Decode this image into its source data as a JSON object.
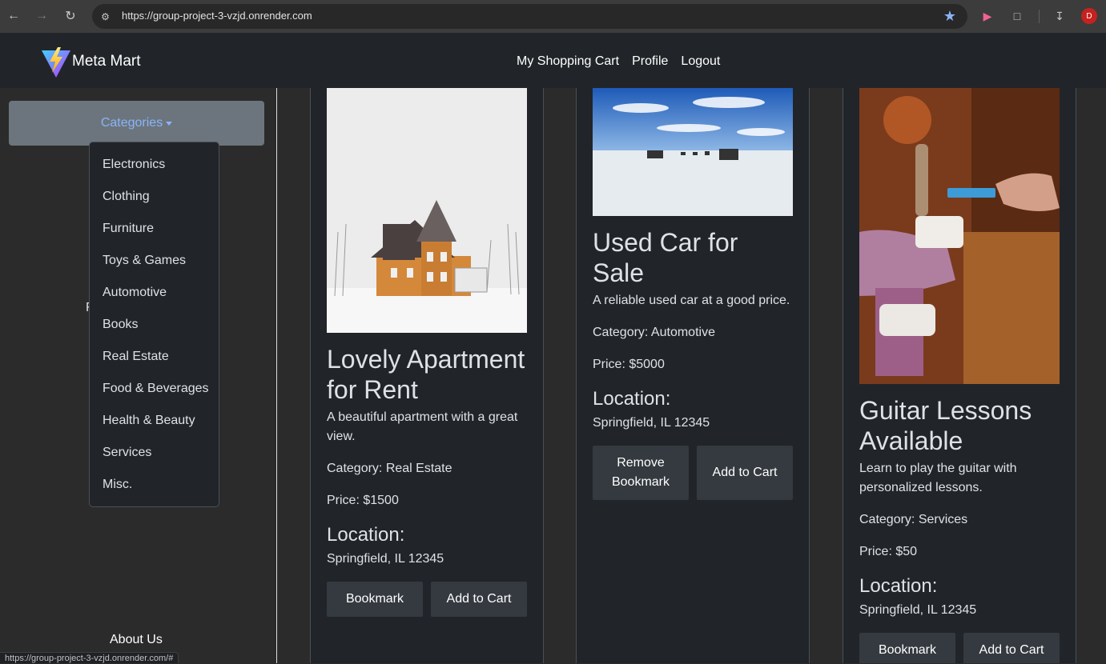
{
  "browser": {
    "url": "https://group-project-3-vzjd.onrender.com",
    "status_url": "https://group-project-3-vzjd.onrender.com/#",
    "avatar_initial": "D"
  },
  "navbar": {
    "brand": "Meta Mart",
    "links": [
      "My Shopping Cart",
      "Profile",
      "Logout"
    ]
  },
  "sidebar": {
    "categories_label": "Categories",
    "hidden_text": "F",
    "dropdown": [
      "Electronics",
      "Clothing",
      "Furniture",
      "Toys & Games",
      "Automotive",
      "Books",
      "Real Estate",
      "Food & Beverages",
      "Health & Beauty",
      "Services",
      "Misc."
    ],
    "about": "About Us"
  },
  "listings": [
    {
      "title": "Lovely Apartment for Rent",
      "description": "A beautiful apartment with a great view.",
      "category": "Category: Real Estate",
      "price": "Price: $1500",
      "location_heading": "Location:",
      "location": "Springfield, IL 12345",
      "buttons": [
        "Bookmark",
        "Add to Cart"
      ]
    },
    {
      "title": "Used Car for Sale",
      "description": "A reliable used car at a good price.",
      "category": "Category: Automotive",
      "price": "Price: $5000",
      "location_heading": "Location:",
      "location": "Springfield, IL 12345",
      "buttons": [
        "Remove Bookmark",
        "Add to Cart"
      ]
    },
    {
      "title": "Guitar Lessons Available",
      "description": "Learn to play the guitar with personalized lessons.",
      "category": "Category: Services",
      "price": "Price: $50",
      "location_heading": "Location:",
      "location": "Springfield, IL 12345",
      "buttons": [
        "Bookmark",
        "Add to Cart"
      ]
    }
  ]
}
